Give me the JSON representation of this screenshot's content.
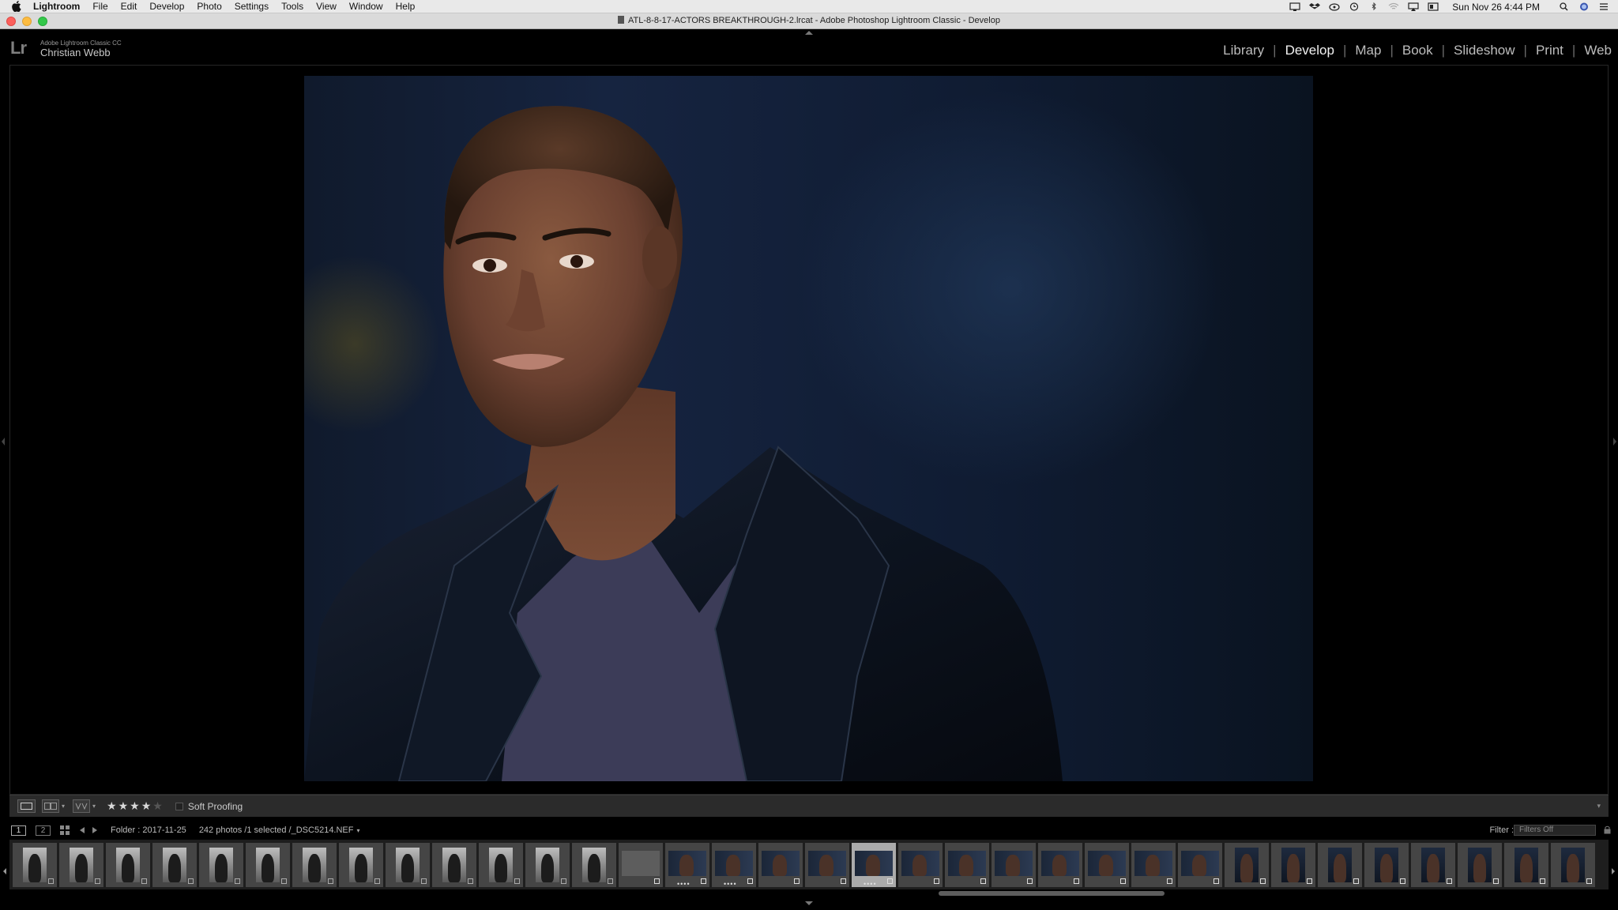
{
  "menubar": {
    "app": "Lightroom",
    "items": [
      "File",
      "Edit",
      "Develop",
      "Photo",
      "Settings",
      "Tools",
      "View",
      "Window",
      "Help"
    ],
    "clock": "Sun Nov 26  4:44 PM",
    "status_icons": [
      "display-icon",
      "dropbox-icon",
      "cloud-icon",
      "time-machine-icon",
      "bluetooth-icon",
      "wifi-icon",
      "airplay-icon",
      "menu-extra-icon",
      "search-icon",
      "siri-icon",
      "list-icon"
    ]
  },
  "window": {
    "title": "ATL-8-8-17-ACTORS BREAKTHROUGH-2.lrcat - Adobe Photoshop Lightroom Classic - Develop"
  },
  "identity": {
    "logo": "Lr",
    "product": "Adobe Lightroom Classic CC",
    "user": "Christian Webb"
  },
  "modules": {
    "items": [
      "Library",
      "Develop",
      "Map",
      "Book",
      "Slideshow",
      "Print",
      "Web"
    ],
    "active": "Develop"
  },
  "toolbar": {
    "rating": 4,
    "rating_max": 5,
    "soft_proofing_label": "Soft Proofing",
    "soft_proofing_checked": false
  },
  "filmstrip_bar": {
    "screen_1": "1",
    "screen_2": "2",
    "folder": "Folder : 2017-11-25",
    "count": "242 photos /1 selected /_DSC5214.NEF",
    "filter_label": "Filter :",
    "filter_value": "Filters Off"
  },
  "filmstrip": {
    "selected_index": 18,
    "scroll_position": 0.55
  },
  "colors": {
    "menubar_bg": "#e9e9e9",
    "module_active": "#f2f2f2",
    "module_inactive": "#bdbdbd",
    "toolbar_bg": "#2b2b2b",
    "filmstrip_cell": "#454545",
    "filmstrip_selected": "#ababab"
  }
}
